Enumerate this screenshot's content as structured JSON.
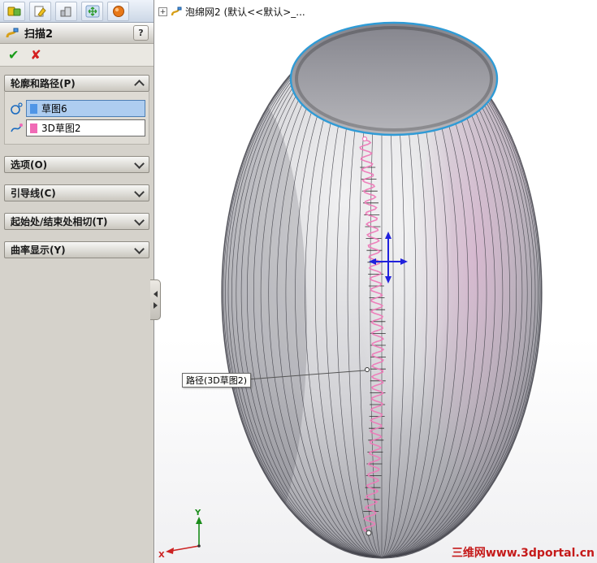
{
  "colors": {
    "accent_blue": "#2f9bd6",
    "path_pink": "#ee7ab8",
    "selection_blue": "#aecdf0",
    "profile_swatch": "#4f95e6",
    "path_swatch": "#f06ab6",
    "watermark_red": "#c51a1a",
    "triad_blue": "#2020dd",
    "axis_x_red": "#cc2222",
    "axis_y_green": "#1a8c1a",
    "wire_gray": "#44444b"
  },
  "panel": {
    "title": "扫描2",
    "help_icon": "?",
    "ok_icon": "✔",
    "cancel_icon": "✘",
    "groups": [
      {
        "label": "轮廓和路径(P)",
        "expanded": true
      },
      {
        "label": "选项(O)",
        "expanded": false
      },
      {
        "label": "引导线(C)",
        "expanded": false
      },
      {
        "label": "起始处/结束处相切(T)",
        "expanded": false
      },
      {
        "label": "曲率显示(Y)",
        "expanded": false
      }
    ],
    "profile_value": "草图6",
    "path_value": "3D草图2"
  },
  "viewport": {
    "breadcrumb_expander": "+",
    "breadcrumb": "泡绵网2 (默认<<默认>_...",
    "tooltip": "路径(3D草图2)",
    "watermark": "三维网www.3dportal.cn",
    "axes": {
      "x": "X",
      "y": "Y"
    }
  }
}
